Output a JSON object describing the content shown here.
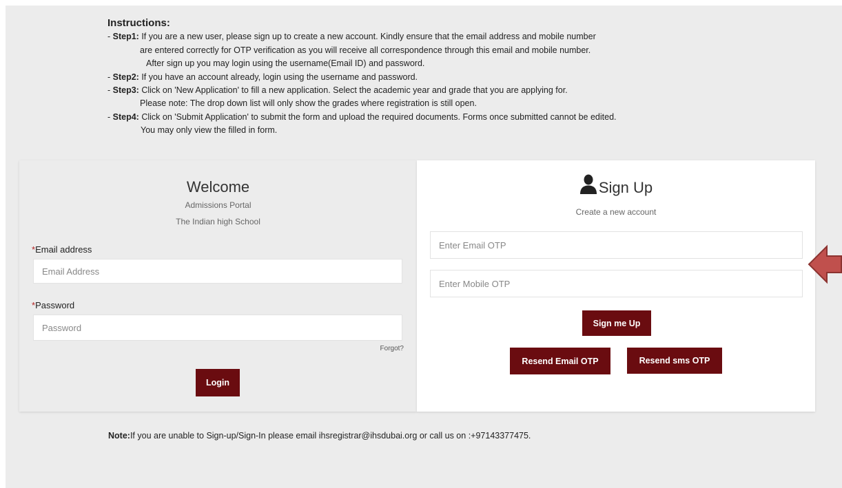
{
  "instructions": {
    "heading": "Instructions:",
    "steps": [
      {
        "prefix": "- ",
        "label": "Step1:",
        "lines": [
          " If you are a new user, please sign up to create a new account. Kindly ensure that the email address and mobile number",
          "are entered correctly for OTP verification as you will receive all correspondence through this email and mobile number.",
          "After sign up you may login using the username(Email ID) and password."
        ]
      },
      {
        "prefix": "- ",
        "label": "Step2:",
        "lines": [
          " If you have an account already, login using the username and password."
        ]
      },
      {
        "prefix": "- ",
        "label": "Step3:",
        "lines": [
          " Click on 'New Application' to fill a new application. Select the academic year and grade that you are applying for.",
          "Please note: The drop down list will only show the grades where registration is still open."
        ]
      },
      {
        "prefix": "- ",
        "label": "Step4:",
        "lines": [
          " Click on 'Submit Application' to submit the form and upload the required documents. Forms once submitted cannot be edited.",
          "You may only view the filled in form."
        ]
      }
    ]
  },
  "login": {
    "title": "Welcome",
    "subtitle1": "Admissions Portal",
    "subtitle2": "The Indian high School",
    "required_mark": "*",
    "email_label": "Email address",
    "email_placeholder": "Email Address",
    "password_label": "Password",
    "password_placeholder": "Password",
    "forgot_link": "Forgot?",
    "login_button": "Login"
  },
  "signup": {
    "title": "Sign Up",
    "subtitle": "Create a new account",
    "icon": "user-icon",
    "email_otp_placeholder": "Enter Email OTP",
    "mobile_otp_placeholder": "Enter Mobile OTP",
    "signup_button": "Sign me Up",
    "resend_email_button": "Resend Email OTP",
    "resend_sms_button": "Resend sms OTP"
  },
  "note": {
    "label": "Note:",
    "text": "If you are unable to Sign-up/Sign-In please email ihsregistrar@ihsdubai.org or call us on :+97143377475."
  },
  "colors": {
    "button": "#6a0c10",
    "background": "#ececec",
    "arrow": "#c0504d",
    "required": "#b22222"
  }
}
